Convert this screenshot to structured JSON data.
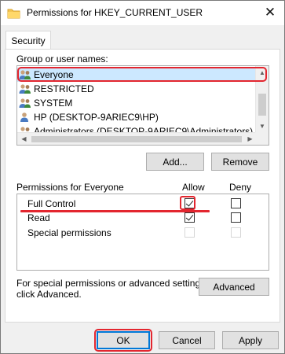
{
  "window": {
    "title": "Permissions for HKEY_CURRENT_USER",
    "close_glyph": "✕"
  },
  "tabs": [
    {
      "label": "Security",
      "active": true
    }
  ],
  "groups": {
    "label": "Group or user names:",
    "items": [
      {
        "label": "Everyone",
        "selected": true,
        "icon": "users-group-icon"
      },
      {
        "label": "RESTRICTED",
        "selected": false,
        "icon": "users-group-icon"
      },
      {
        "label": "SYSTEM",
        "selected": false,
        "icon": "users-group-icon"
      },
      {
        "label": "HP (DESKTOP-9ARIEC9\\HP)",
        "selected": false,
        "icon": "user-icon"
      },
      {
        "label": "Administrators (DESKTOP-9ARIEC9\\Administrators)",
        "selected": false,
        "icon": "users-group-icon"
      }
    ]
  },
  "group_buttons": {
    "add": "Add...",
    "remove": "Remove"
  },
  "permissions": {
    "title": "Permissions for Everyone",
    "col_allow": "Allow",
    "col_deny": "Deny",
    "rows": [
      {
        "label": "Full Control",
        "allow": true,
        "deny": false,
        "disabled": false
      },
      {
        "label": "Read",
        "allow": true,
        "deny": false,
        "disabled": false
      },
      {
        "label": "Special permissions",
        "allow": false,
        "deny": false,
        "disabled": true
      }
    ]
  },
  "advanced": {
    "text_line1": "For special permissions or advanced settings,",
    "text_line2": "click Advanced.",
    "button": "Advanced"
  },
  "footer": {
    "ok": "OK",
    "cancel": "Cancel",
    "apply": "Apply"
  },
  "colors": {
    "annotation": "#e3262f",
    "selection": "#cce8ff",
    "default_button_border": "#0078d7"
  }
}
